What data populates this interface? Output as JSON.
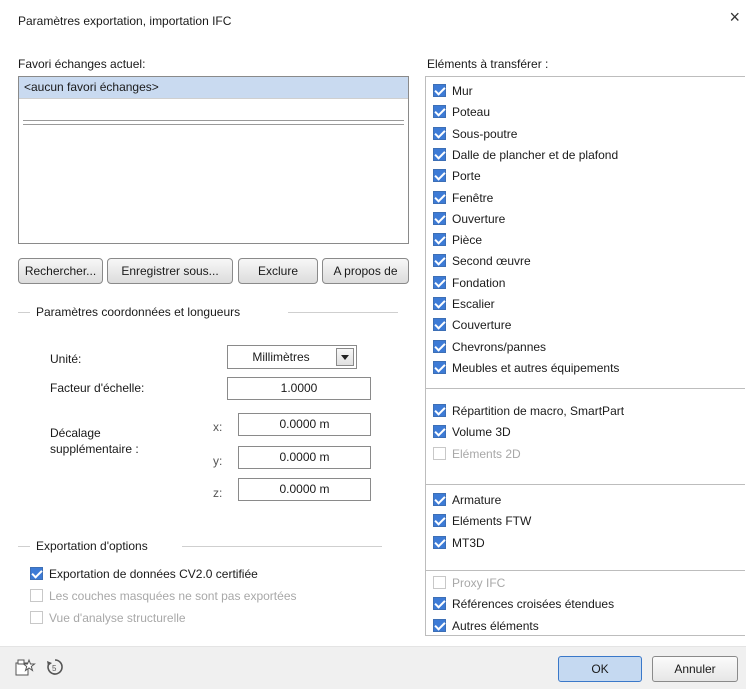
{
  "window": {
    "title": "Paramètres exportation, importation IFC",
    "close_glyph": "×"
  },
  "favorites": {
    "label": "Favori échanges actuel:",
    "items": [
      "<aucun favori échanges>"
    ]
  },
  "buttons": {
    "search": "Rechercher...",
    "save_as": "Enregistrer sous...",
    "exclude": "Exclure",
    "about": "A propos de"
  },
  "coords": {
    "legend": "Paramètres coordonnées et longueurs",
    "unit_label": "Unité:",
    "unit_value": "Millimètres",
    "scale_label": "Facteur d'échelle:",
    "scale_value": "1.0000",
    "offset_label_1": "Décalage",
    "offset_label_2": "supplémentaire :",
    "x_label": "x:",
    "x_value": "0.0000 m",
    "y_label": "y:",
    "y_value": "0.0000 m",
    "z_label": "z:",
    "z_value": "0.0000 m"
  },
  "options": {
    "legend": "Exportation d'options",
    "items": [
      {
        "label": "Exportation de données CV2.0 certifiée",
        "checked": true,
        "enabled": true
      },
      {
        "label": "Les couches masquées ne sont pas exportées",
        "checked": false,
        "enabled": false
      },
      {
        "label": "Vue d'analyse structurelle",
        "checked": false,
        "enabled": false
      }
    ]
  },
  "elements": {
    "label": "Eléments à transférer :",
    "group1": [
      {
        "label": "Mur",
        "checked": true,
        "enabled": true
      },
      {
        "label": "Poteau",
        "checked": true,
        "enabled": true
      },
      {
        "label": "Sous-poutre",
        "checked": true,
        "enabled": true
      },
      {
        "label": "Dalle de plancher et de plafond",
        "checked": true,
        "enabled": true
      },
      {
        "label": "Porte",
        "checked": true,
        "enabled": true
      },
      {
        "label": "Fenêtre",
        "checked": true,
        "enabled": true
      },
      {
        "label": "Ouverture",
        "checked": true,
        "enabled": true
      },
      {
        "label": "Pièce",
        "checked": true,
        "enabled": true
      },
      {
        "label": "Second œuvre",
        "checked": true,
        "enabled": true
      },
      {
        "label": "Fondation",
        "checked": true,
        "enabled": true
      },
      {
        "label": "Escalier",
        "checked": true,
        "enabled": true
      },
      {
        "label": "Couverture",
        "checked": true,
        "enabled": true
      },
      {
        "label": "Chevrons/pannes",
        "checked": true,
        "enabled": true
      },
      {
        "label": "Meubles et autres équipements",
        "checked": true,
        "enabled": true
      }
    ],
    "group2": [
      {
        "label": "Répartition de macro, SmartPart",
        "checked": true,
        "enabled": true
      },
      {
        "label": "Volume 3D",
        "checked": true,
        "enabled": true
      },
      {
        "label": "Eléments 2D",
        "checked": false,
        "enabled": false
      }
    ],
    "group3": [
      {
        "label": "Armature",
        "checked": true,
        "enabled": true
      },
      {
        "label": "Eléments FTW",
        "checked": true,
        "enabled": true
      },
      {
        "label": "MT3D",
        "checked": true,
        "enabled": true
      }
    ],
    "group4": [
      {
        "label": "Proxy IFC",
        "checked": false,
        "enabled": false
      },
      {
        "label": "Références croisées étendues",
        "checked": true,
        "enabled": true
      },
      {
        "label": "Autres éléments",
        "checked": true,
        "enabled": true
      }
    ]
  },
  "footer": {
    "ok": "OK",
    "cancel": "Annuler",
    "icons": [
      "favorite-icon",
      "reset-icon"
    ]
  },
  "colors": {
    "accent": "#3d7bd6",
    "selection": "#c9daf0",
    "ok_button": "#c5d9f1"
  }
}
